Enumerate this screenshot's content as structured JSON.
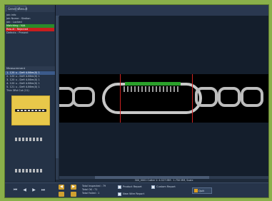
{
  "tabs": {
    "general": "General",
    "result": "Result"
  },
  "info_rows": [
    {
      "text": "Job info",
      "style": ""
    },
    {
      "text": "Job Name : Station",
      "style": ""
    },
    {
      "text": "Job : Locked",
      "style": ""
    },
    {
      "text": "Matching : N/A",
      "style": "green"
    },
    {
      "text": "Result : Rejected",
      "style": "red"
    },
    {
      "text": "Defects : Present",
      "style": ""
    }
  ],
  "measurements": {
    "header": "Measurement",
    "rows": [
      "1. 120 u - Defi 4.86m(0) 1",
      "2. 120 u - Defi 4.86m(0) 1",
      "3. 120 u - Defi 4.86m(0) 1",
      "4. 120 u - Defi 4.86m(0) 1",
      "5. 121 u - Defi 4.86m(0) 1",
      "Thin 3Rd Cut (11)"
    ]
  },
  "status_line": "300_0001 Cutter 1: 4.527 MM : 1.750 MM, Scale",
  "counters": {
    "total_inspected": "Total Inspected : 79",
    "total_ok": "Total OK : 71",
    "total_failed": "Total Failed : 1"
  },
  "buttons": {
    "product_report": "Product Report",
    "custom_report": "Custom Report",
    "new_wire_report": "New Wire Report",
    "quit": "Quit"
  },
  "colors": {
    "accent_green": "#2a8a2a",
    "accent_red": "#c81e1e",
    "frame": "#8ab04a"
  }
}
